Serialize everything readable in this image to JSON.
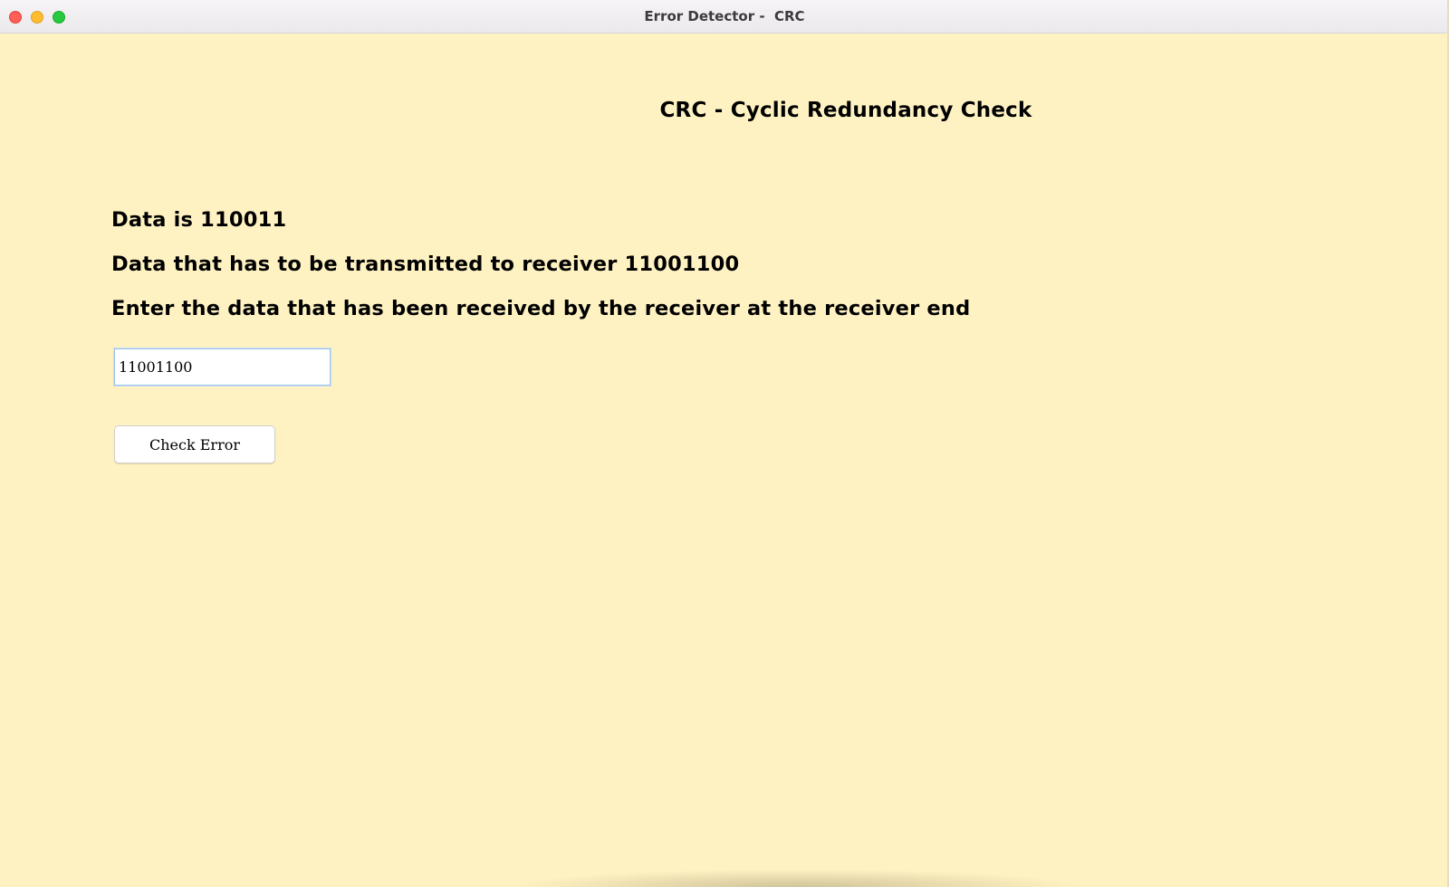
{
  "window": {
    "title": "Error Detector -  CRC"
  },
  "main": {
    "heading": "CRC - Cyclic Redundancy Check",
    "data_line": "Data is 110011",
    "transmit_line": "Data that has to be transmitted to receiver 11001100",
    "prompt_line": "Enter the data that has been received by the receiver at the receiver end",
    "received_input_value": "11001100",
    "check_button_label": "Check Error"
  },
  "colors": {
    "window_background": "#fff2c2",
    "input_focus_border": "#9ec4ea",
    "close_button": "#ff5f57",
    "minimize_button": "#febc2e",
    "maximize_button": "#28c840"
  },
  "icons": [
    "close-icon",
    "minimize-icon",
    "maximize-icon"
  ]
}
